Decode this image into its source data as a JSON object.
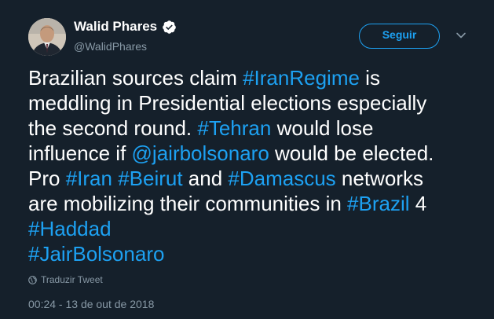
{
  "author": {
    "name": "Walid Phares",
    "handle": "@WalidPhares",
    "verified": true
  },
  "follow_button": {
    "label": "Seguir"
  },
  "menu_icon": "chevron-down-icon",
  "tweet": {
    "lines": [
      [
        {
          "t": "Brazilian sources claim "
        },
        {
          "t": "#IranRegime",
          "link": true
        },
        {
          "t": " is"
        }
      ],
      [
        {
          "t": "meddling in Presidential elections especially"
        }
      ],
      [
        {
          "t": "the second round.  "
        },
        {
          "t": "#Tehran",
          "link": true
        },
        {
          "t": " would lose"
        }
      ],
      [
        {
          "t": "influence if "
        },
        {
          "t": "@jairbolsonaro",
          "link": true
        },
        {
          "t": " would be elected."
        }
      ],
      [
        {
          "t": "Pro "
        },
        {
          "t": "#Iran",
          "link": true
        },
        {
          "t": " "
        },
        {
          "t": "#Beirut",
          "link": true
        },
        {
          "t": " and "
        },
        {
          "t": "#Damascus",
          "link": true
        },
        {
          "t": " networks"
        }
      ],
      [
        {
          "t": "are mobilizing their communities in "
        },
        {
          "t": "#Brazil",
          "link": true
        },
        {
          "t": " 4"
        }
      ],
      [
        {
          "t": "#Haddad",
          "link": true
        }
      ],
      [
        {
          "t": "#JairBolsonaro",
          "link": true
        }
      ]
    ]
  },
  "translate_label": "Traduzir Tweet",
  "timestamp": "00:24 - 13 de out de 2018",
  "colors": {
    "background": "#15202b",
    "link": "#1da1f2",
    "secondary_text": "#8899a6"
  }
}
